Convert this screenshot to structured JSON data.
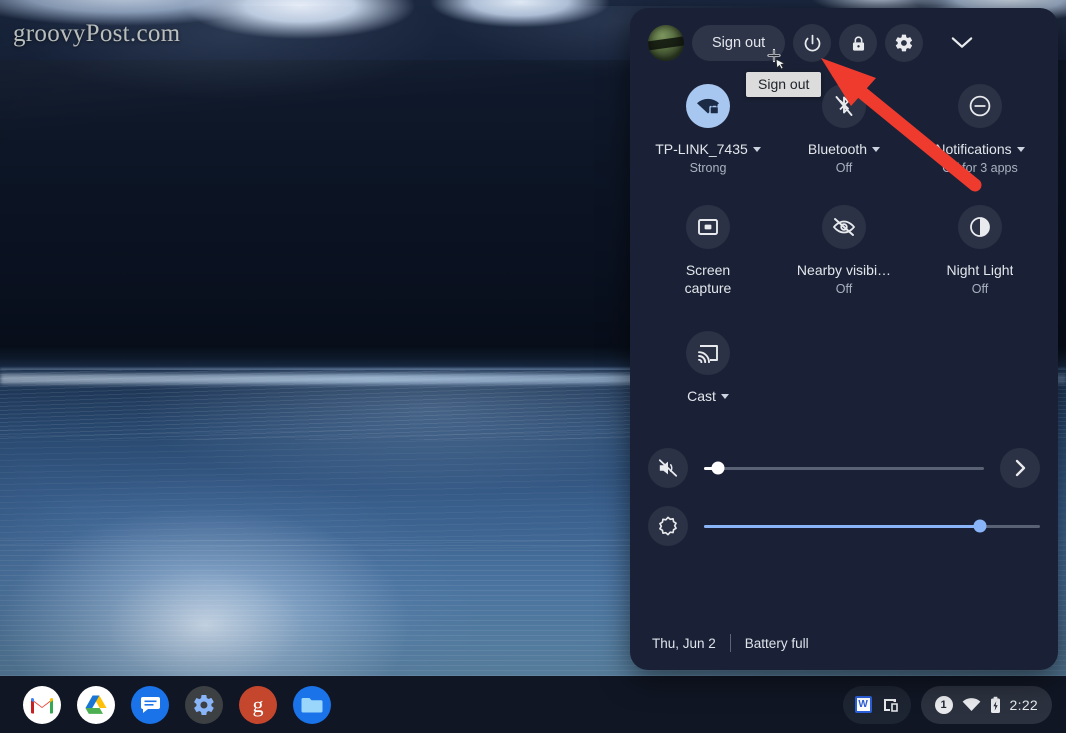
{
  "wallpaper": {
    "watermark": "groovyPost.com"
  },
  "quick_settings": {
    "header": {
      "avatar_name": "user-avatar",
      "sign_out_label": "Sign out",
      "power_label": "power-icon",
      "lock_label": "lock-icon",
      "settings_label": "gear-icon",
      "collapse_label": "chevron-down-icon"
    },
    "tooltip": {
      "text": "Sign out"
    },
    "tiles": [
      {
        "id": "network",
        "label": "TP-LINK_7435",
        "sub": "Strong",
        "icon": "wifi-lock-icon",
        "active": true,
        "caret": true
      },
      {
        "id": "bluetooth",
        "label": "Bluetooth",
        "sub": "Off",
        "icon": "bluetooth-off-icon",
        "active": false,
        "caret": true
      },
      {
        "id": "notifications",
        "label": "Notifications",
        "sub": "Off for 3 apps",
        "icon": "do-not-disturb-icon",
        "active": false,
        "caret": true
      },
      {
        "id": "screen-capture",
        "label": "Screen capture",
        "sub": "",
        "icon": "screen-capture-icon",
        "active": false,
        "caret": false,
        "two_line": true
      },
      {
        "id": "nearby-visibility",
        "label": "Nearby visibi…",
        "sub": "Off",
        "icon": "eye-off-icon",
        "active": false,
        "caret": false
      },
      {
        "id": "night-light",
        "label": "Night Light",
        "sub": "Off",
        "icon": "night-light-icon",
        "active": false,
        "caret": false
      },
      {
        "id": "cast",
        "label": "Cast",
        "sub": "",
        "icon": "cast-icon",
        "active": false,
        "caret": true
      }
    ],
    "sliders": {
      "volume": {
        "icon": "volume-muted-icon",
        "value": 5,
        "next_icon": "chevron-right-icon"
      },
      "brightness": {
        "icon": "brightness-icon",
        "value": 82
      }
    },
    "footer": {
      "date": "Thu, Jun 2",
      "battery": "Battery full"
    }
  },
  "shelf": {
    "apps": [
      {
        "id": "gmail",
        "name": "gmail-app-icon"
      },
      {
        "id": "drive",
        "name": "google-drive-app-icon"
      },
      {
        "id": "messages",
        "name": "messages-app-icon"
      },
      {
        "id": "settings",
        "name": "settings-app-icon"
      },
      {
        "id": "groovy",
        "name": "groovypost-app-icon",
        "glyph": "g"
      },
      {
        "id": "files",
        "name": "files-app-icon"
      }
    ],
    "tray": {
      "word_glyph": "W",
      "window_icon": "window-snap-icon",
      "notification_count": "1",
      "wifi_icon": "wifi-icon",
      "battery_icon": "battery-charging-icon",
      "time": "2:22"
    }
  },
  "annotation": {
    "arrow_color": "#ef3b2d"
  }
}
